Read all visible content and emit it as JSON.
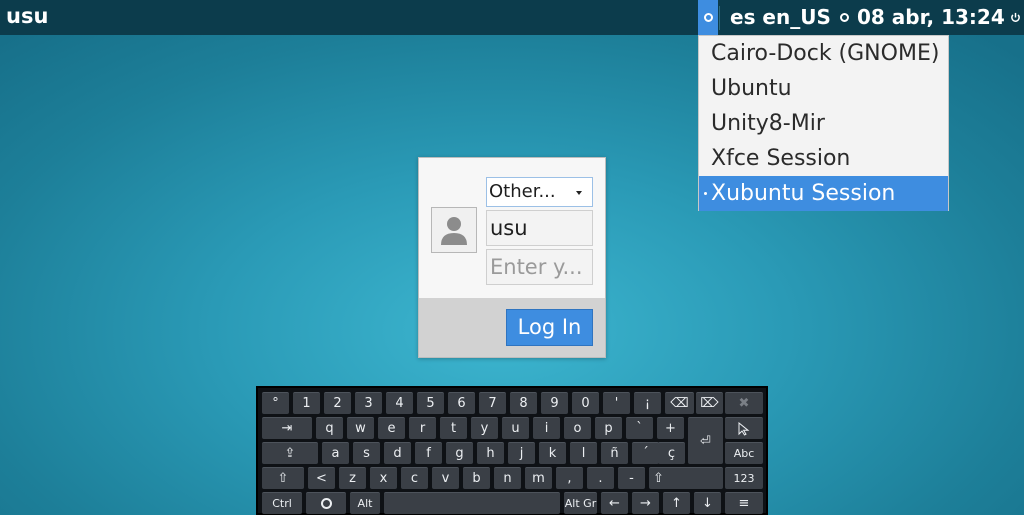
{
  "panel": {
    "hostname": "usu",
    "language": "es en_US",
    "clock": "08 abr, 13:24"
  },
  "session_menu": {
    "items": [
      "Cairo-Dock (GNOME)",
      "Ubuntu",
      "Unity8-Mir",
      "Xfce Session",
      "Xubuntu Session"
    ],
    "selected": "Xubuntu Session"
  },
  "login": {
    "user_combo": "Other...",
    "username": "usu",
    "password_placeholder": "Enter y...",
    "login_button": "Log In"
  },
  "keyboard": {
    "row1": [
      "°",
      "1",
      "2",
      "3",
      "4",
      "5",
      "6",
      "7",
      "8",
      "9",
      "0",
      "'",
      "¡"
    ],
    "row2": [
      "q",
      "w",
      "e",
      "r",
      "t",
      "y",
      "u",
      "i",
      "o",
      "p",
      "`",
      "+"
    ],
    "row3": [
      "a",
      "s",
      "d",
      "f",
      "g",
      "h",
      "j",
      "k",
      "l",
      "ñ",
      "´",
      "ç"
    ],
    "row4": [
      "<",
      "z",
      "x",
      "c",
      "v",
      "b",
      "n",
      "m",
      ",",
      ".",
      "-"
    ],
    "tab": "⇥",
    "capslock": "⇪",
    "shift": "⇧",
    "enter": "⏎",
    "ctrl": "Ctrl",
    "alt": "Alt",
    "altgr": "Alt Gr",
    "abc": "Abc",
    "num": "123",
    "arrows": [
      "←",
      "→",
      "↑",
      "↓"
    ],
    "menu": "≡",
    "backspace": "⌫",
    "delete": "⌦",
    "close": "✖"
  },
  "colors": {
    "panel_bg": "#0c3c4c",
    "accent": "#3e8de0",
    "desktop": "#2a9ab6"
  }
}
